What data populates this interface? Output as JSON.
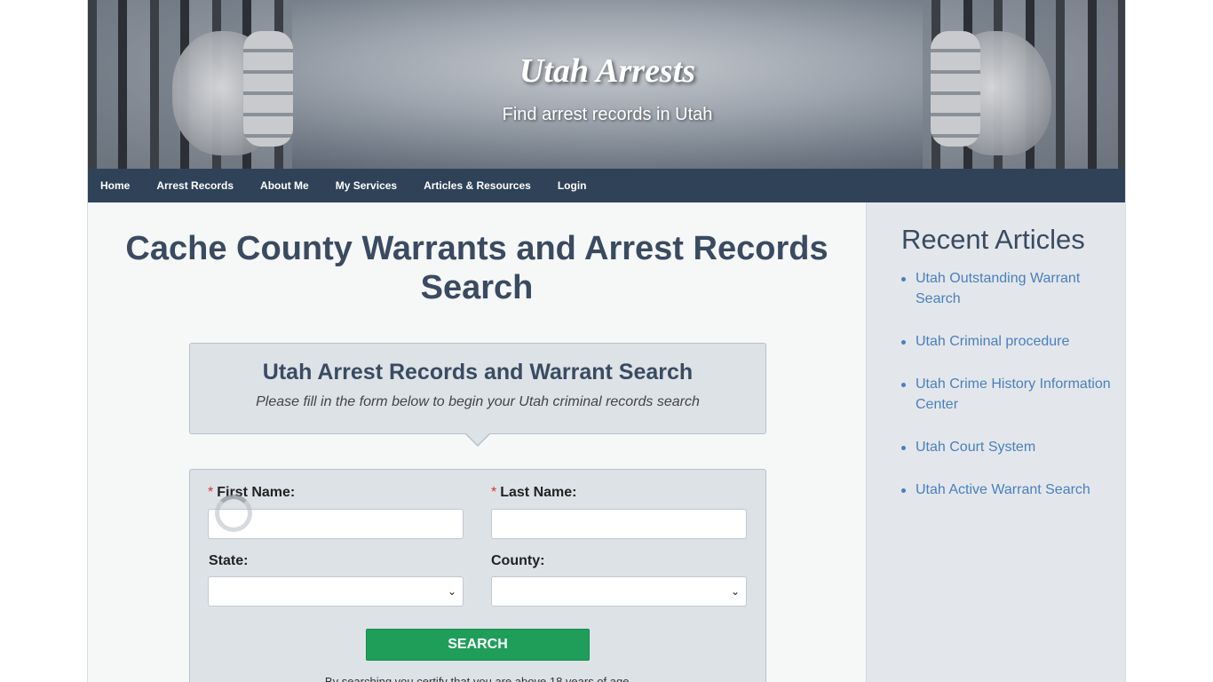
{
  "header": {
    "site_title": "Utah Arrests",
    "tagline": "Find arrest records in Utah"
  },
  "nav": {
    "items": [
      {
        "label": "Home"
      },
      {
        "label": "Arrest Records"
      },
      {
        "label": "About Me"
      },
      {
        "label": "My Services"
      },
      {
        "label": "Articles & Resources"
      },
      {
        "label": "Login"
      }
    ]
  },
  "main": {
    "page_title": "Cache County Warrants and Arrest Records Search",
    "callout": {
      "title": "Utah Arrest Records and Warrant Search",
      "subtitle": "Please fill in the form below to begin your Utah criminal records search"
    },
    "form": {
      "required_mark": "*",
      "first_name_label": "First Name:",
      "first_name_value": "",
      "last_name_label": "Last Name:",
      "last_name_value": "",
      "state_label": "State:",
      "state_value": "",
      "county_label": "County:",
      "county_value": "",
      "search_label": "SEARCH",
      "certify_text": "By searching you certify that you are above 18 years of age."
    }
  },
  "sidebar": {
    "title": "Recent Articles",
    "articles": [
      {
        "label": "Utah Outstanding Warrant Search"
      },
      {
        "label": "Utah Criminal procedure"
      },
      {
        "label": "Utah Crime History Information Center"
      },
      {
        "label": "Utah Court System"
      },
      {
        "label": "Utah Active Warrant Search"
      }
    ]
  },
  "colors": {
    "nav_bg": "#2f4258",
    "title_text": "#3a4b61",
    "link": "#4a7fbd",
    "search_button": "#1f9e5a",
    "required": "#d9342b"
  },
  "icons": {
    "select_chevron": "chevron-down-icon",
    "loading": "spinner-icon"
  }
}
